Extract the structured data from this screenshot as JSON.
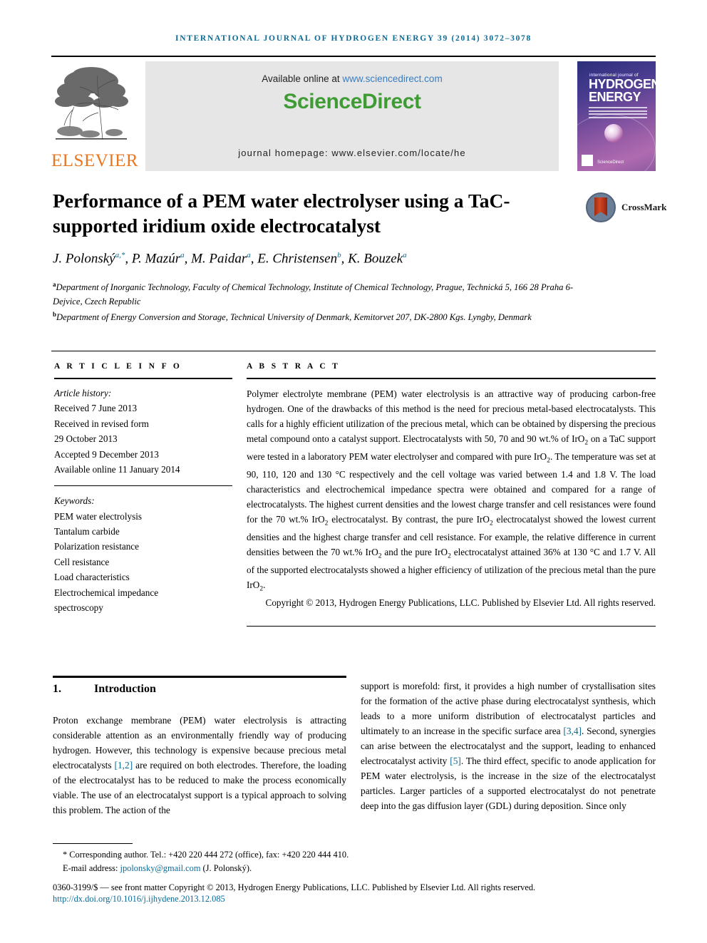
{
  "running_head": "INTERNATIONAL JOURNAL OF HYDROGEN ENERGY 39 (2014) 3072–3078",
  "masthead": {
    "publisher_name": "ELSEVIER",
    "available_prefix": "Available online at ",
    "available_url": "www.sciencedirect.com",
    "sciencedirect_logo": "ScienceDirect",
    "journal_homepage": "journal homepage: www.elsevier.com/locate/he",
    "cover": {
      "line1": "international journal of",
      "line2": "HYDROGEN",
      "line3": "ENERGY",
      "sd_label": "ScienceDirect"
    },
    "colors": {
      "header_blue": "#0b6a96",
      "elsevier_orange": "#e87722",
      "sciencedirect_green": "#3f9c35",
      "link_blue": "#3a7dbf",
      "banner_grey": "#e6e6e6"
    }
  },
  "article": {
    "title": "Performance of a PEM water electrolyser using a TaC-supported iridium oxide electrocatalyst",
    "crossmark_label": "CrossMark",
    "authors_html": "J. Polonský<sup>a,*</sup>, P. Mazúr<sup>a</sup>, M. Paidar<sup>a</sup>, E. Christensen<sup>b</sup>, K. Bouzek<sup>a</sup>",
    "affiliation_a": "Department of Inorganic Technology, Faculty of Chemical Technology, Institute of Chemical Technology, Prague, Technická 5, 166 28 Praha 6-Dejvice, Czech Republic",
    "affiliation_b": "Department of Energy Conversion and Storage, Technical University of Denmark, Kemitorvet 207, DK-2800 Kgs. Lyngby, Denmark"
  },
  "info": {
    "heading": "A R T I C L E  I N F O",
    "history_label": "Article history:",
    "history": [
      "Received 7 June 2013",
      "Received in revised form",
      "29 October 2013",
      "Accepted 9 December 2013",
      "Available online 11 January 2014"
    ],
    "keywords_label": "Keywords:",
    "keywords": [
      "PEM water electrolysis",
      "Tantalum carbide",
      "Polarization resistance",
      "Cell resistance",
      "Load characteristics",
      "Electrochemical impedance",
      "spectroscopy"
    ]
  },
  "abstract": {
    "heading": "A B S T R A C T",
    "body_html": "Polymer electrolyte membrane (PEM) water electrolysis is an attractive way of producing carbon-free hydrogen. One of the drawbacks of this method is the need for precious metal-based electrocatalysts. This calls for a highly efficient utilization of the precious metal, which can be obtained by dispersing the precious metal compound onto a catalyst support. Electrocatalysts with 50, 70 and 90 wt.% of IrO<sub>2</sub> on a TaC support were tested in a laboratory PEM water electrolyser and compared with pure IrO<sub>2</sub>. The temperature was set at 90, 110, 120 and 130 &deg;C respectively and the cell voltage was varied between 1.4 and 1.8 V. The load characteristics and electrochemical impedance spectra were obtained and compared for a range of electrocatalysts. The highest current densities and the lowest charge transfer and cell resistances were found for the 70 wt.% IrO<sub>2</sub> electrocatalyst. By contrast, the pure IrO<sub>2</sub> electrocatalyst showed the lowest current densities and the highest charge transfer and cell resistance. For example, the relative difference in current densities between the 70 wt.% IrO<sub>2</sub> and the pure IrO<sub>2</sub> electrocatalyst attained 36% at 130 &deg;C and 1.7 V. All of the supported electrocatalysts showed a higher efficiency of utilization of the precious metal than the pure IrO<sub>2</sub>.",
    "copyright": "Copyright © 2013, Hydrogen Energy Publications, LLC. Published by Elsevier Ltd. All rights reserved."
  },
  "main": {
    "section_number": "1.",
    "section_title": "Introduction",
    "left_column_html": "Proton exchange membrane (PEM) water electrolysis is attracting considerable attention as an environmentally friendly way of producing hydrogen. However, this technology is expensive because precious metal electrocatalysts <span class=\"cite\">[1,2]</span> are required on both electrodes. Therefore, the loading of the electrocatalyst has to be reduced to make the process economically viable. The use of an electrocatalyst support is a typical approach to solving this problem. The action of the",
    "right_column_html": "support is morefold: first, it provides a high number of crystallisation sites for the formation of the active phase during electrocatalyst synthesis, which leads to a more uniform distribution of electrocatalyst particles and ultimately to an increase in the specific surface area <span class=\"cite\">[3,4]</span>. Second, synergies can arise between the electrocatalyst and the support, leading to enhanced electrocatalyst activity <span class=\"cite\">[5]</span>. The third effect, specific to anode application for PEM water electrolysis, is the increase in the size of the electrocatalyst particles. Larger particles of a supported electrocatalyst do not penetrate deep into the gas diffusion layer (GDL) during deposition. Since only"
  },
  "footer": {
    "corresponding_html": "* Corresponding author. Tel.: +420 220 444 272 (office), fax: +420 220 444 410.",
    "email_html": "E-mail address: <span class=\"link\">jpolonsky@gmail.com</span> (J. Polonský).",
    "issn_line": "0360-3199/$ — see front matter Copyright © 2013, Hydrogen Energy Publications, LLC. Published by Elsevier Ltd. All rights reserved.",
    "doi": "http://dx.doi.org/10.1016/j.ijhydene.2013.12.085"
  }
}
